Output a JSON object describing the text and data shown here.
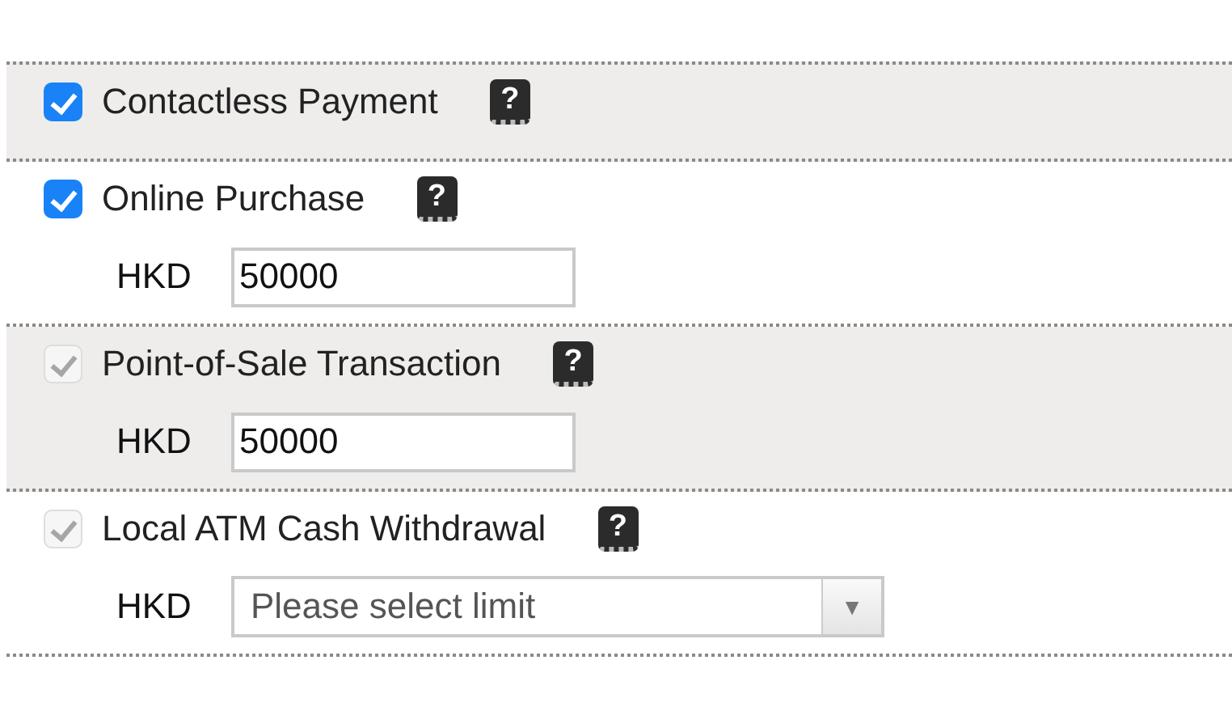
{
  "options": [
    {
      "label": "Contactless Payment",
      "checked": true,
      "disabled": false,
      "highlighted": true,
      "help": "?"
    },
    {
      "label": "Online Purchase",
      "checked": true,
      "disabled": false,
      "highlighted": false,
      "help": "?",
      "limit": {
        "kind": "input",
        "currency": "HKD",
        "value": "50000"
      }
    },
    {
      "label": "Point-of-Sale Transaction",
      "checked": true,
      "disabled": true,
      "highlighted": true,
      "help": "?",
      "limit": {
        "kind": "input",
        "currency": "HKD",
        "value": "50000"
      }
    },
    {
      "label": "Local ATM Cash Withdrawal",
      "checked": true,
      "disabled": true,
      "highlighted": false,
      "help": "?",
      "limit": {
        "kind": "select",
        "currency": "HKD",
        "placeholder": "Please select limit",
        "arrow": "▼"
      }
    }
  ]
}
